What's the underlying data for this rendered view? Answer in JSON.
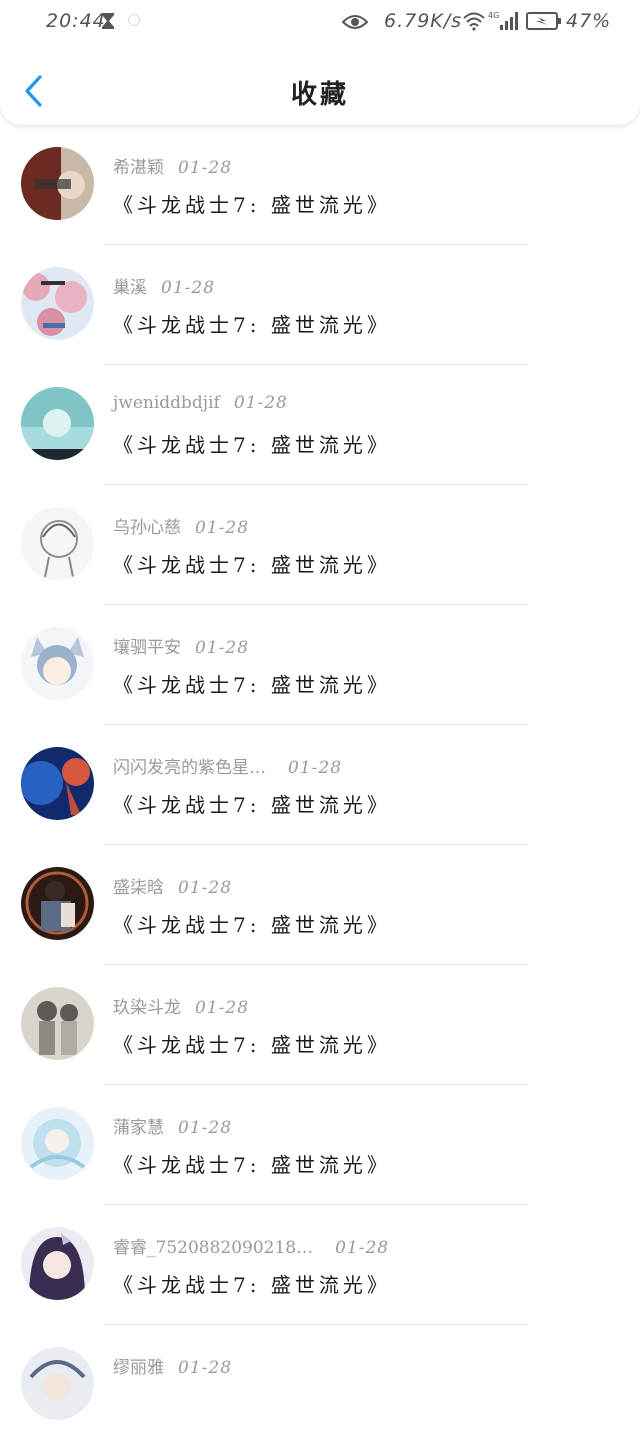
{
  "status_bar": {
    "time": "20:44",
    "speed": "6.79K/s",
    "network": "4G",
    "battery": "47%"
  },
  "header": {
    "title": "收藏"
  },
  "items": [
    {
      "name": "希湛颖",
      "date": "01-28",
      "title": "《斗龙战士7: 盛世流光》",
      "avatar_colors": [
        "#6b2b22",
        "#c9b8a8"
      ]
    },
    {
      "name": "巢溪",
      "date": "01-28",
      "title": "《斗龙战士7: 盛世流光》",
      "avatar_colors": [
        "#e6a9b8",
        "#4a6fa8"
      ]
    },
    {
      "name": "jweniddbdjif",
      "date": "01-28",
      "title": "《斗龙战士7: 盛世流光》",
      "avatar_colors": [
        "#7fc5c8",
        "#2d4a56"
      ]
    },
    {
      "name": "乌孙心慈",
      "date": "01-28",
      "title": "《斗龙战士7: 盛世流光》",
      "avatar_colors": [
        "#f2f0ec",
        "#8a8f9a"
      ]
    },
    {
      "name": "壤驷平安",
      "date": "01-28",
      "title": "《斗龙战士7: 盛世流光》",
      "avatar_colors": [
        "#eef2f6",
        "#9bb2cc"
      ]
    },
    {
      "name": "闪闪发亮的紫色星…",
      "date": "01-28",
      "title": "《斗龙战士7: 盛世流光》",
      "avatar_colors": [
        "#1d3f8f",
        "#c24a3a"
      ]
    },
    {
      "name": "盛柒晗",
      "date": "01-28",
      "title": "《斗龙战士7: 盛世流光》",
      "avatar_colors": [
        "#2b1914",
        "#b05b3c"
      ]
    },
    {
      "name": "玖染斗龙",
      "date": "01-28",
      "title": "《斗龙战士7: 盛世流光》",
      "avatar_colors": [
        "#d9d4cc",
        "#5c5a57"
      ]
    },
    {
      "name": "蒲家慧",
      "date": "01-28",
      "title": "《斗龙战士7: 盛世流光》",
      "avatar_colors": [
        "#d8ecf4",
        "#9cc9e0"
      ]
    },
    {
      "name": "睿睿_7520882090218…",
      "date": "01-28",
      "title": "《斗龙战士7: 盛世流光》",
      "avatar_colors": [
        "#3a2d52",
        "#c7bfd6"
      ]
    },
    {
      "name": "缪丽雅",
      "date": "01-28",
      "title": "",
      "avatar_colors": [
        "#e9edf2",
        "#5b6a86"
      ]
    }
  ],
  "colors": {
    "accent": "#2196f3",
    "meta_text": "#9a9a9a",
    "divider": "#ededed"
  }
}
